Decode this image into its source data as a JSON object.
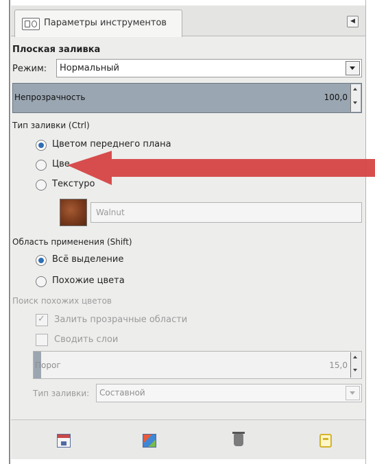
{
  "tab": {
    "label": "Параметры инструментов",
    "icon": "tool-options-icon",
    "menu_icon": "tab-menu-icon"
  },
  "tool": {
    "title": "Плоская заливка"
  },
  "mode": {
    "label": "Режим:",
    "value": "Нормальный"
  },
  "opacity": {
    "label": "Непрозрачность",
    "value": "100,0"
  },
  "fill_type": {
    "label": "Тип заливки  (Ctrl)",
    "options": [
      {
        "label": "Цветом переднего плана",
        "selected": true
      },
      {
        "label": "Цве",
        "selected": false
      },
      {
        "label": "Текстуро",
        "selected": false
      }
    ],
    "pattern_name": "Walnut"
  },
  "affected_area": {
    "label": "Область применения  (Shift)",
    "options": [
      {
        "label": "Всё выделение",
        "selected": true
      },
      {
        "label": "Похожие цвета",
        "selected": false
      }
    ]
  },
  "similar_colors": {
    "label": "Поиск похожих цветов",
    "fill_transparent": {
      "label": "Залить прозрачные области",
      "checked": true
    },
    "sample_merged": {
      "label": "Сводить слои",
      "checked": false
    },
    "threshold": {
      "label": "Порог",
      "value": "15,0"
    },
    "fill_by": {
      "label": "Тип заливки:",
      "value": "Составной"
    }
  },
  "bottom_icons": [
    "save-preset-icon",
    "restore-preset-icon",
    "delete-preset-icon",
    "reset-defaults-icon"
  ],
  "colors": {
    "arrow": "#d64545",
    "selected_radio": "#2f6eb5",
    "slider_fill": "#9aa6b2"
  }
}
